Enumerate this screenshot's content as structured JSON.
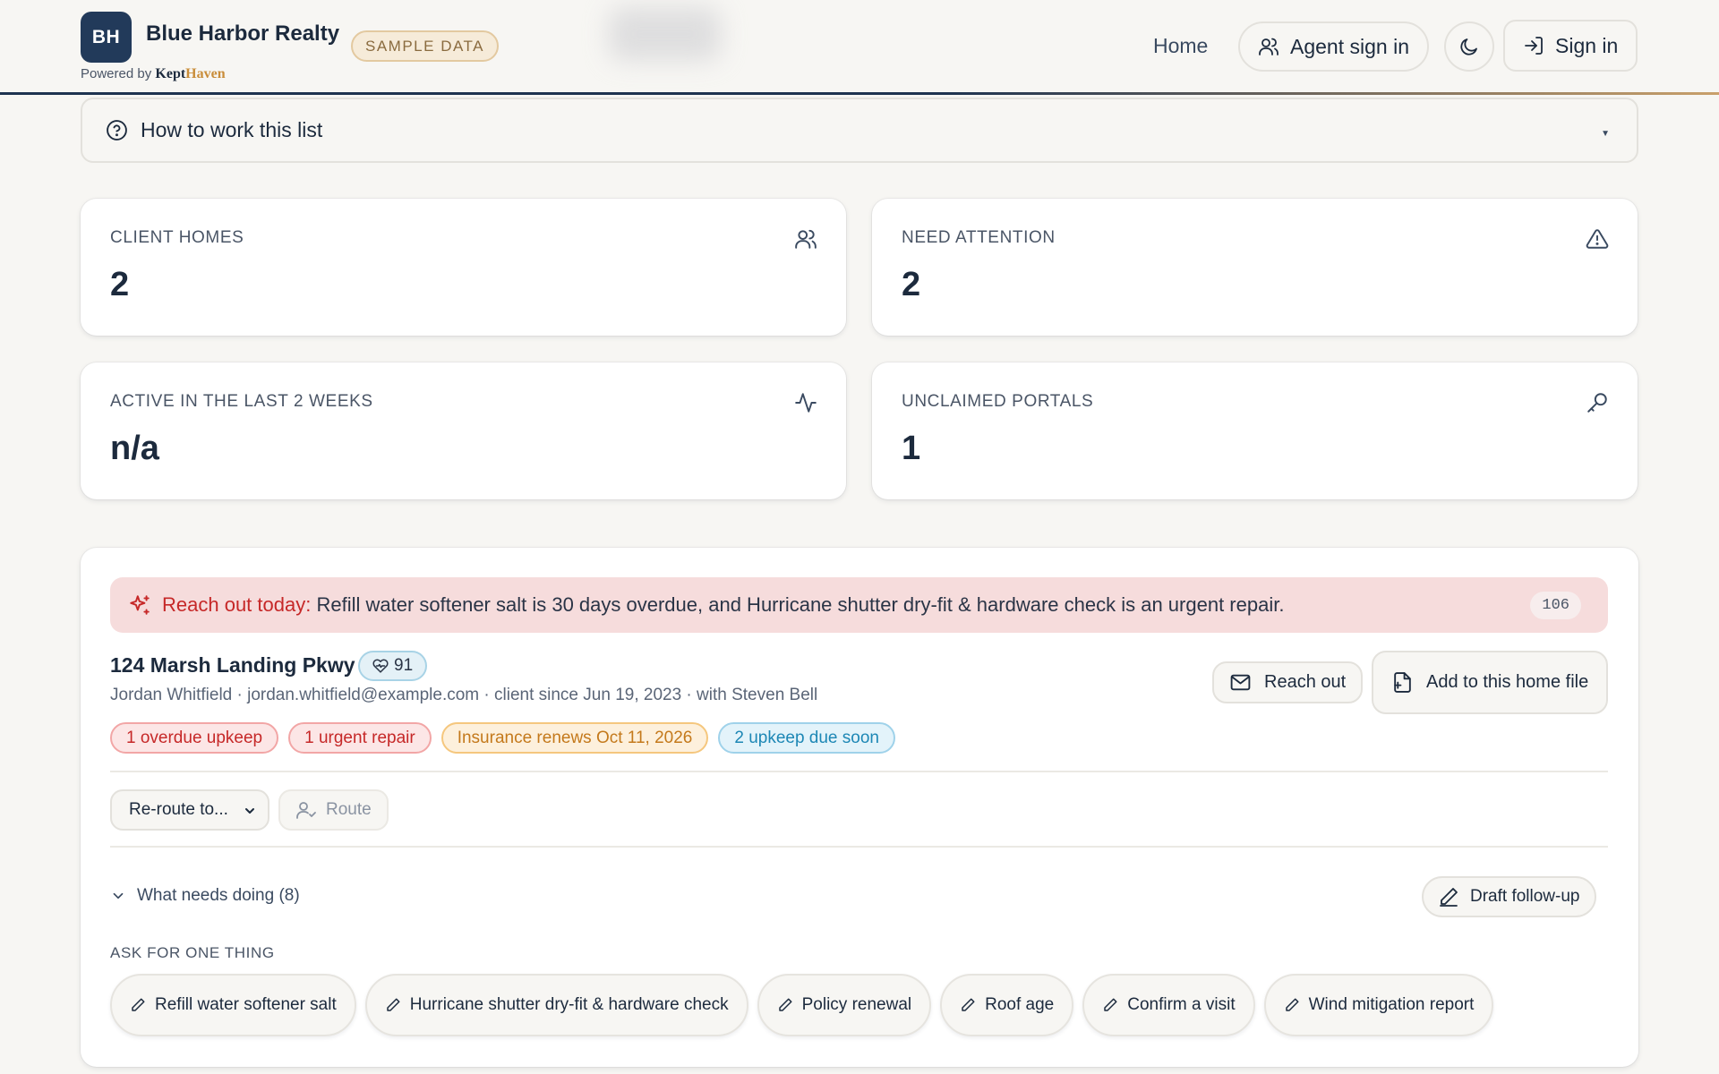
{
  "header": {
    "logo_initials": "BH",
    "brand_name": "Blue Harbor Realty",
    "sample_badge": "SAMPLE DATA",
    "powered_by": "Powered by",
    "powered_kept": "Kept",
    "powered_haven": "Haven",
    "nav_home": "Home",
    "agent_sign_in": "Agent sign in",
    "sign_in": "Sign in",
    "icons": [
      "users-icon",
      "moon-icon",
      "sign-in-icon"
    ]
  },
  "howto": {
    "label": "How to work this list",
    "icon": "help-circle-icon"
  },
  "stats": [
    {
      "label": "CLIENT HOMES",
      "value": "2",
      "icon": "users-icon"
    },
    {
      "label": "NEED ATTENTION",
      "value": "2",
      "icon": "alert-triangle-icon"
    },
    {
      "label": "ACTIVE IN THE LAST 2 WEEKS",
      "value": "n/a",
      "icon": "activity-icon"
    },
    {
      "label": "UNCLAIMED PORTALS",
      "value": "1",
      "icon": "key-icon"
    }
  ],
  "client": {
    "alert_lead": "Reach out today:",
    "alert_text": "Refill water softener salt is 30 days overdue, and Hurricane shutter dry-fit & hardware check is an urgent repair.",
    "alert_count": "106",
    "address": "124 Marsh Landing Pkwy ›",
    "score": "91",
    "meta": "Jordan Whitfield · jordan.whitfield@example.com · client since Jun 19, 2023 · with Steven Bell",
    "tags": [
      {
        "label": "1 overdue upkeep",
        "tone": "red"
      },
      {
        "label": "1 urgent repair",
        "tone": "red"
      },
      {
        "label": "Insurance renews Oct 11, 2026",
        "tone": "orange"
      },
      {
        "label": "2 upkeep due soon",
        "tone": "blue"
      }
    ],
    "reach_out": "Reach out",
    "add_file": "Add to this home file",
    "reroute_value": "Re-route to...",
    "route": "Route",
    "needs_doing": "What needs doing (8)",
    "draft_followup": "Draft follow-up",
    "ask_label": "ASK FOR ONE THING",
    "asks": [
      "Refill water softener salt",
      "Hurricane shutter dry-fit & hardware check",
      "Policy renewal",
      "Roof age",
      "Confirm a visit",
      "Wind mitigation report"
    ]
  },
  "colors": {
    "brand_navy": "#223a5a",
    "alert_red": "#c62828",
    "accent_gold": "#c98d3a"
  }
}
